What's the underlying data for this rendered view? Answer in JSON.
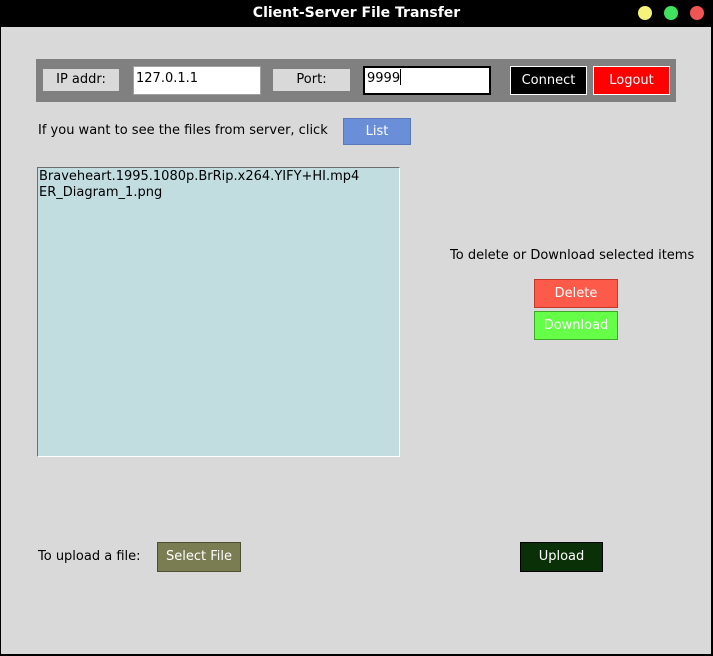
{
  "window": {
    "title": "Client-Server File Transfer",
    "controls": [
      "minimize",
      "maximize",
      "close"
    ],
    "control_colors": {
      "minimize": "#f5f37a",
      "maximize": "#3fe15e",
      "close": "#f05555"
    }
  },
  "connection": {
    "ip_label": "IP addr:",
    "ip_value": "127.0.1.1",
    "port_label": "Port:",
    "port_value": "9999",
    "connect_label": "Connect",
    "logout_label": "Logout"
  },
  "list_section": {
    "prompt": "If you want to see the files from server, click",
    "list_label": "List"
  },
  "files": [
    "Braveheart.1995.1080p.BrRip.x264.YIFY+HI.mp4",
    "ER_Diagram_1.png"
  ],
  "actions": {
    "prompt": "To delete or Download selected items",
    "delete_label": "Delete",
    "download_label": "Download"
  },
  "upload": {
    "prompt": "To upload a file:",
    "select_label": "Select File",
    "upload_label": "Upload"
  },
  "colors": {
    "background": "#d9d9d9",
    "list_bg": "#c2dde0",
    "list_button": "#6a8fd8",
    "delete_button": "#fe5a4a",
    "download_button": "#64ff46",
    "connect_button": "#000000",
    "logout_button": "#ff0000",
    "select_button": "#7a7c52",
    "upload_button": "#0a3008"
  }
}
